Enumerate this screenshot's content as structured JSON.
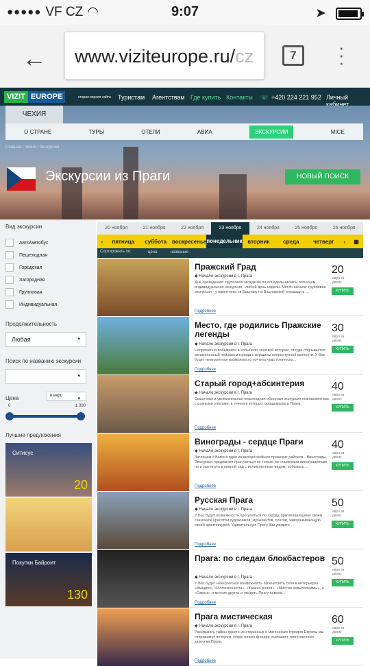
{
  "status": {
    "carrier": "VF CZ",
    "time": "9:07",
    "signal": "●●●●●"
  },
  "browser": {
    "url_main": "www.viziteurope.ru/",
    "url_fade": "cz",
    "tab_count": "7"
  },
  "site": {
    "logo_a": "VIZIT",
    "logo_b": "EUROPE",
    "old_version": "старая версия сайта",
    "nav": [
      "Туристам",
      "Агентствам",
      "Где купить",
      "Контакты"
    ],
    "phone": "+420 224 221 952",
    "cabinet": "Личный кабинет"
  },
  "hero": {
    "country_tab": "ЧЕХИЯ",
    "nav": [
      "О СТРАНЕ",
      "ТУРЫ",
      "ОТЕЛИ",
      "АВИА",
      "ЭКСКУРСИИ",
      "MICE"
    ],
    "crumb": "Главная / Чехия / Экскурсии",
    "title": "Экскурсии из Праги",
    "new_search": "НОВЫЙ ПОИСК"
  },
  "side": {
    "type_label": "Вид экскурсии",
    "types": [
      "Авто/автобус",
      "Пешеходная",
      "Городская",
      "Загородная",
      "Групповая",
      "Индивидуальная"
    ],
    "duration_label": "Продолжительность",
    "duration_value": "Любая",
    "search_label": "Поиск по названию экскурсии",
    "price_label": "Цена",
    "currency": "в евро",
    "min": "0",
    "max": "1 000",
    "best_label": "Лучшие предложения",
    "promos": [
      "Ситисус",
      "",
      "Покупки Байроит"
    ],
    "promo_prices": [
      "20",
      "",
      "130"
    ]
  },
  "dates": [
    "20 ноября",
    "21 ноября",
    "22 ноября",
    "23 ноября",
    "24 ноября",
    "25 ноября",
    "26 ноября"
  ],
  "days": [
    "пятница",
    "суббота",
    "воскресенье",
    "понедельник",
    "вторник",
    "среда",
    "четверг"
  ],
  "sort": {
    "label": "Сортировать по:",
    "price": "цена",
    "name": "название"
  },
  "tours": [
    {
      "title": "Пражский Град",
      "from": "Начало экскурсии в г. Прага",
      "desc": "Дни проведения: групповая экскурсия по понедельникам и пятницам, индивидуальная экскурсия - любой день недели. Место начала: групповая экскурсия - у памятника св Вацлаву на Вацлавской площади в ...",
      "price": "20",
      "unit": "евро за двоих",
      "buy": "КУПИТЬ",
      "more": "Подробнее"
    },
    {
      "title": "Место, где родились Пражские легенды",
      "from": "Начало экскурсии в г. Прага",
      "desc": "Непременно побывайте в колыбели чешской истории, откуда открывается великолепный пейзажем города с вершины неприступной крепости. У Вас будет невероятная возможность почтить чудо готичеcко...",
      "price": "30",
      "unit": "евро за двоих",
      "buy": "КУПИТЬ",
      "more": "Подробнее"
    },
    {
      "title": "Старый город+абсинтерия",
      "from": "Начало экскурсии в г. Прага",
      "desc": "Сказочная и увлекательная пешеходная обзорная экскурсия познакомит вас с разными эпохами, в течение которых складывалась Прага.",
      "price": "40",
      "unit": "евро за двоих",
      "buy": "КУПИТЬ",
      "more": "Подробнее"
    },
    {
      "title": "Винограды - сердце Праги",
      "from": "Начало экскурсии в г. Прага",
      "desc": "Заглянем с Вами в один из интереснейших пражских районов - Винограды. Экскурсия предлагает прогуляться не только по старинным виноградникам, но и заглянуть в пивной сад с великолепным видом, побывать ...",
      "price": "40",
      "unit": "евро за двоих",
      "buy": "КУПИТЬ",
      "more": "Подробнее"
    },
    {
      "title": "Русская Прага",
      "from": "Начало экскурсии в г. Прага",
      "desc": "У Вас будет возможность прогуляться по городу, притягивающему своей сказочной красотой художников, музыкантов, поэтов, завораживающую своей архитектурой. Удивительную Прагу. Вы увидите ...",
      "price": "50",
      "unit": "евро за двоих",
      "buy": "КУПИТЬ",
      "more": "Подробнее"
    },
    {
      "title": "Прага: по следам блокбастеров",
      "from": "Начало экскурсии в г. Прага",
      "desc": "У Вас будет невероятная возможность запечатлеть себя в интерьерах «Амадея», «Иллюзиониста», «Казино рояля», «Миссии невыполнимы», и «Омена» и многих других и увидеть Прагу совсем...",
      "price": "50",
      "unit": "евро за двоих",
      "buy": "КУПИТЬ",
      "more": "Подробнее"
    },
    {
      "title": "Прага мистическая",
      "from": "Начало экскурсии в г. Прага",
      "desc": "Раскрывать тайны одного из старинных и магических городов Европы мы отправимся вечером, когда только фонари освещают таинственные закоулки Праги.",
      "price": "60",
      "unit": "евро за двоих",
      "buy": "КУПИТЬ",
      "more": "Подробнее"
    }
  ],
  "colors": {
    "accent": "#2fb85f",
    "dark": "#16353e",
    "yellow": "#f4cf00"
  }
}
